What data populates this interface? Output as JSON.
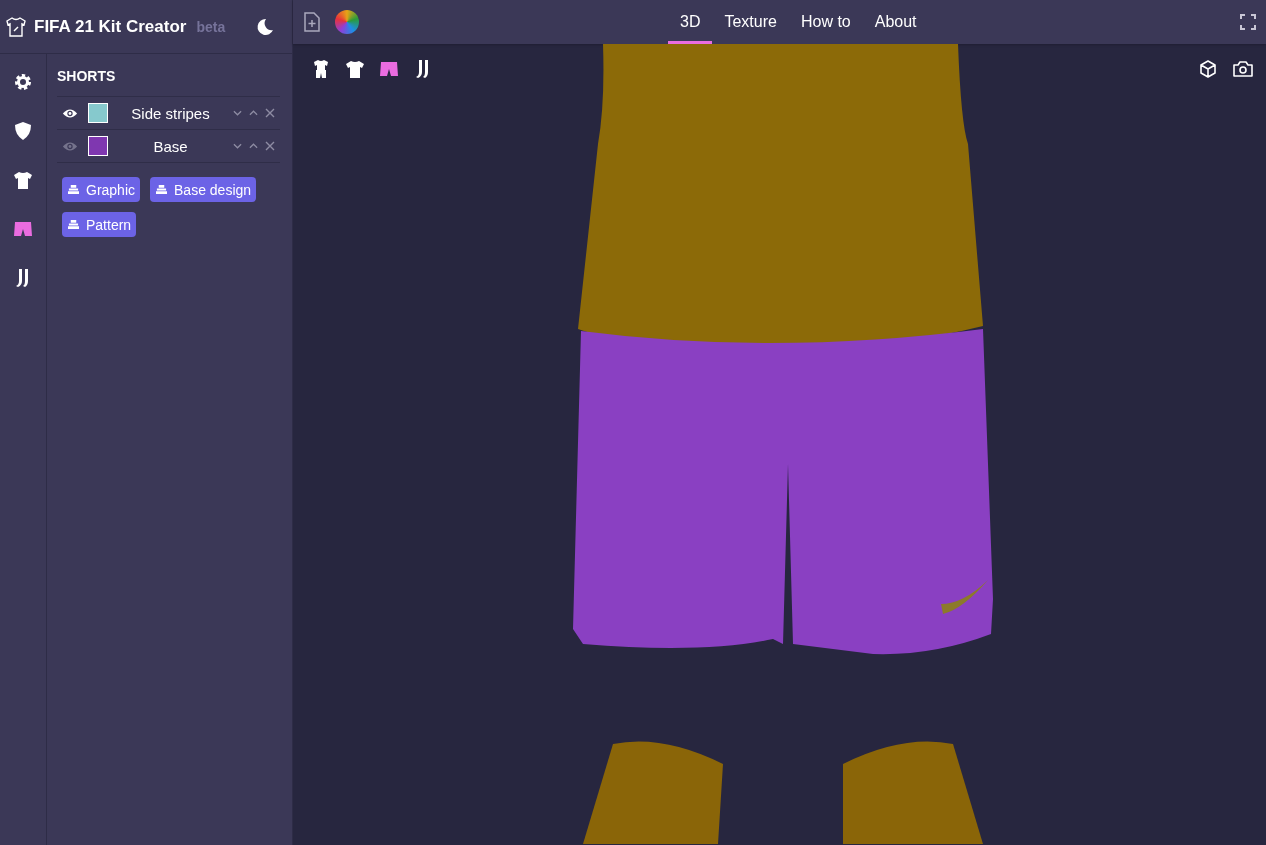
{
  "app": {
    "title": "FIFA 21 Kit Creator",
    "badge": "beta"
  },
  "rail": [
    {
      "selected": false
    },
    {
      "selected": false
    },
    {
      "selected": false
    },
    {
      "selected": true
    },
    {
      "selected": false
    }
  ],
  "panel": {
    "heading": "SHORTS",
    "layers": [
      {
        "name": "Side stripes",
        "visible": true,
        "color": "#86c9cd"
      },
      {
        "name": "Base",
        "visible": false,
        "color": "#7f37b0"
      }
    ],
    "add_buttons": [
      "Graphic",
      "Base design",
      "Pattern"
    ]
  },
  "tabs": [
    {
      "label": "3D",
      "selected": true
    },
    {
      "label": "Texture",
      "selected": false
    },
    {
      "label": "How to",
      "selected": false
    },
    {
      "label": "About",
      "selected": false
    }
  ],
  "parts": [
    {
      "selected": false
    },
    {
      "selected": false
    },
    {
      "selected": true
    },
    {
      "selected": false
    }
  ]
}
